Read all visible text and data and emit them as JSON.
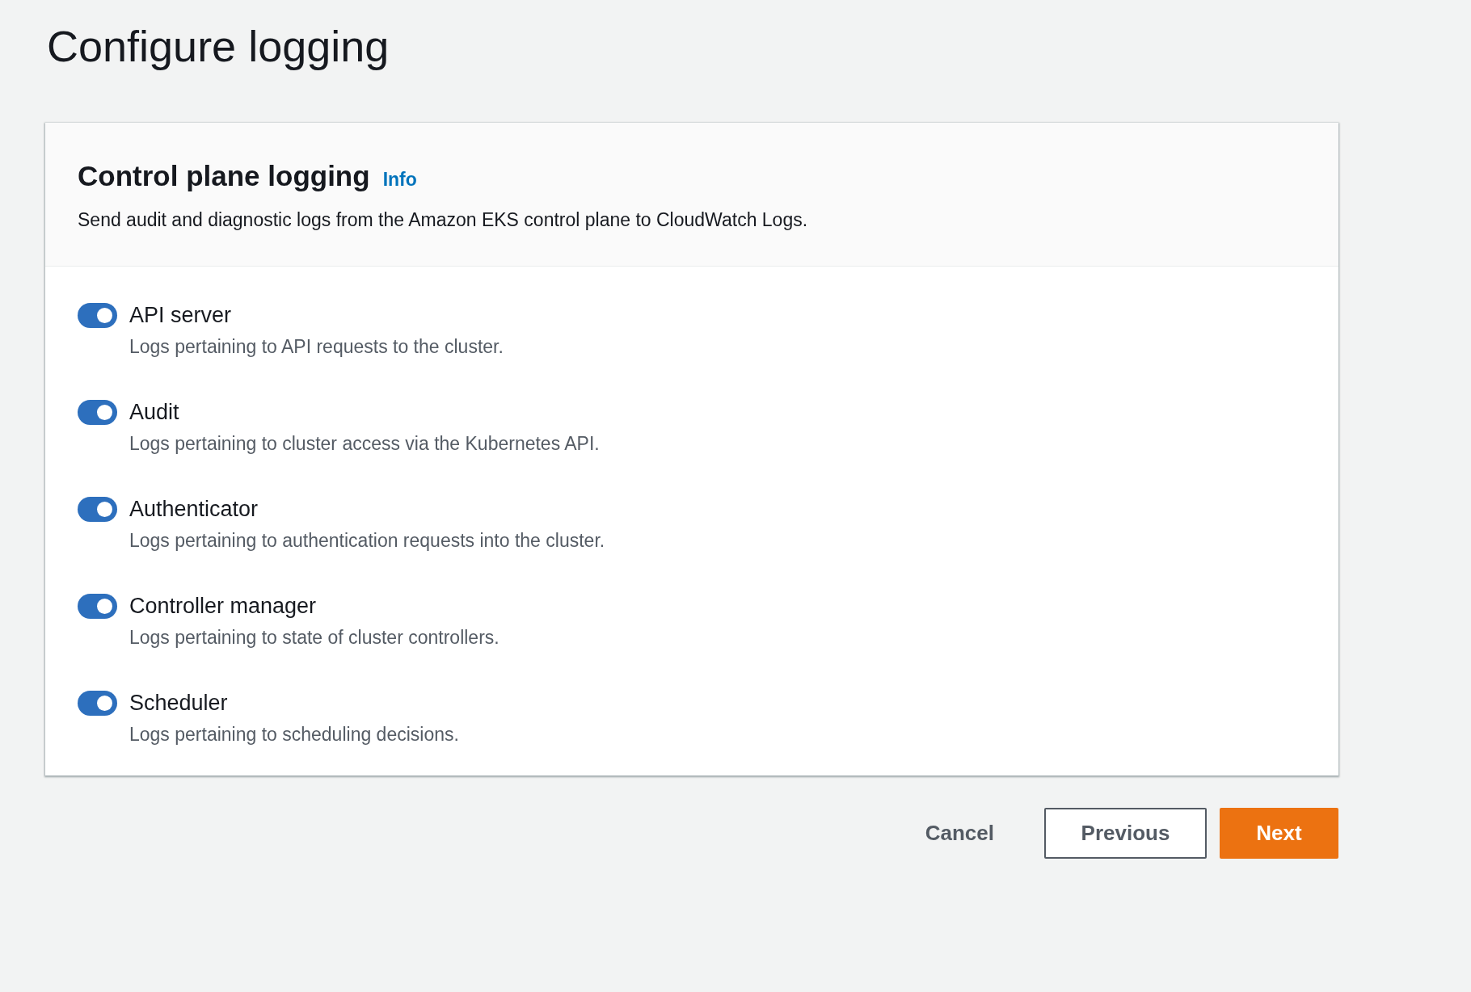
{
  "page": {
    "title": "Configure logging"
  },
  "panel": {
    "title": "Control plane logging",
    "info_link": "Info",
    "description": "Send audit and diagnostic logs from the Amazon EKS control plane to CloudWatch Logs.",
    "options": [
      {
        "label": "API server",
        "description": "Logs pertaining to API requests to the cluster.",
        "on": true
      },
      {
        "label": "Audit",
        "description": "Logs pertaining to cluster access via the Kubernetes API.",
        "on": true
      },
      {
        "label": "Authenticator",
        "description": "Logs pertaining to authentication requests into the cluster.",
        "on": true
      },
      {
        "label": "Controller manager",
        "description": "Logs pertaining to state of cluster controllers.",
        "on": true
      },
      {
        "label": "Scheduler",
        "description": "Logs pertaining to scheduling decisions.",
        "on": true
      }
    ]
  },
  "buttons": [
    {
      "label": "Cancel",
      "kind": "link"
    },
    {
      "label": "Previous",
      "kind": "normal"
    },
    {
      "label": "Next",
      "kind": "primary"
    }
  ]
}
